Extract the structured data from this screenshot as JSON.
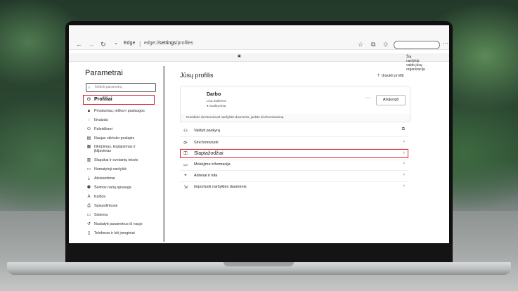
{
  "browser": {
    "brand": "Edge",
    "url_prefix": "edge://",
    "url_bold": "settings",
    "url_suffix": "/profiles",
    "managed_notice": "Šią naršyklę valdo jūsų organizacija"
  },
  "sidebar": {
    "title": "Parametrai",
    "search_placeholder": "Ieškoti parametrų",
    "active_item": "Profiliai",
    "items": [
      {
        "label": "Privatumas, ieška ir paslaugos",
        "icon": "lock-icon"
      },
      {
        "label": "Išvaizda",
        "icon": "appearance-icon"
      },
      {
        "label": "Paleidžiant",
        "icon": "power-icon"
      },
      {
        "label": "Naujas skirtuko puslapis",
        "icon": "new-tab-icon"
      },
      {
        "label": "Iškirpimas, kopijavimas ir",
        "label2": "įklijavimas",
        "icon": "clipboard-icon"
      },
      {
        "label": "Slapukai ir svetainių teisės",
        "icon": "cookie-icon"
      },
      {
        "label": "Numatytoji naršyklė",
        "icon": "browser-icon"
      },
      {
        "label": "Atsisiuntimai",
        "icon": "download-icon"
      },
      {
        "label": "Šeimos narių apsauga",
        "icon": "family-icon"
      },
      {
        "label": "Kalbos",
        "icon": "language-icon"
      },
      {
        "label": "Spausdintuvai",
        "icon": "printer-icon"
      },
      {
        "label": "Sistema",
        "icon": "system-icon"
      },
      {
        "label": "Nustatyti parametrus iš naujo",
        "icon": "reset-icon"
      },
      {
        "label": "Telefonas ir kiti įrenginiai",
        "icon": "phone-icon"
      }
    ]
  },
  "main": {
    "title": "Jūsų profilis",
    "add_profile": "Įtraukti profilį",
    "profile": {
      "name": "Darbo",
      "email": "Lisa.Stulkiene",
      "sync_status": "Suaktyvinta",
      "signout_button": "Atsijungti",
      "more": "···"
    },
    "sync_banner": "Norėdami sinchronizuoti naršyklės duomenis, junkite sinchronizavimą",
    "rows": [
      {
        "label": "Valdyti paskyrą",
        "arrow": "⧉",
        "icon": "person-icon"
      },
      {
        "label": "Sinchronizuoti",
        "arrow": "›",
        "icon": "sync-icon"
      },
      {
        "label": "Slaptažodžiai",
        "arrow": "›",
        "icon": "key-icon"
      },
      {
        "label": "Mokėjimo informacija",
        "arrow": "›",
        "icon": "card-icon"
      },
      {
        "label": "Adresai ir kita",
        "arrow": "›",
        "icon": "location-icon"
      },
      {
        "label": "Importuoti naršyklės duomenis",
        "arrow": "›",
        "icon": "import-icon"
      }
    ]
  },
  "colors": {
    "highlight": "#d6242a",
    "accent": "#0067b8"
  }
}
